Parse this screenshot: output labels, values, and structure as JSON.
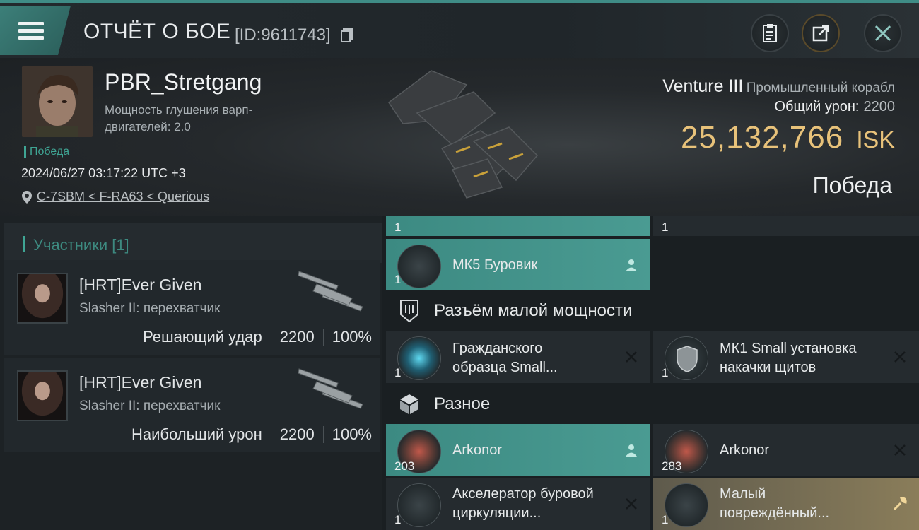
{
  "topbar": {
    "title": "ОТЧЁТ О БОЕ",
    "report_id": "[ID:9611743]"
  },
  "pilot": {
    "name": "PBR_Stretgang",
    "desc": "Мощность глушения варп-двигателей: 2.0",
    "tag": "Победа",
    "datetime": "2024/06/27 03:17:22 UTC +3",
    "location": "C-7SBM < F-RA63 < Querious"
  },
  "ship": {
    "name": "Venture III",
    "class": "Промышленный корабл",
    "total_damage_label": "Общий урон:",
    "total_damage_value": "2200",
    "isk_value": "25,132,766",
    "isk_currency": "ISK",
    "result": "Победа"
  },
  "participants": {
    "title": "Участники [1]",
    "items": [
      {
        "name": "[HRT]Ever Given",
        "ship": "Slasher II: перехватчик",
        "role": "Решающий удар",
        "damage": "2200",
        "percent": "100%"
      },
      {
        "name": "[HRT]Ever Given",
        "ship": "Slasher II: перехватчик",
        "role": "Наибольший урон",
        "damage": "2200",
        "percent": "100%"
      }
    ]
  },
  "fitting": {
    "top_left_qty": "1",
    "top_right_qty": "1",
    "mk5": {
      "label": "МК5 Буровик",
      "qty": "1"
    },
    "low_power_title": "Разъём малой мощности",
    "low_left": {
      "label": "Гражданского образца Small...",
      "qty": "1"
    },
    "low_right": {
      "label": "МК1 Small установка накачки щитов",
      "qty": "1"
    },
    "misc_title": "Разное",
    "misc_left": {
      "label": "Arkonor",
      "qty": "203"
    },
    "misc_right": {
      "label": "Arkonor",
      "qty": "283"
    },
    "bottom_left": {
      "label": "Акселератор буровой циркуляции...",
      "qty": "1"
    },
    "bottom_right": {
      "label": "Малый повреждённый...",
      "qty": "1"
    }
  }
}
